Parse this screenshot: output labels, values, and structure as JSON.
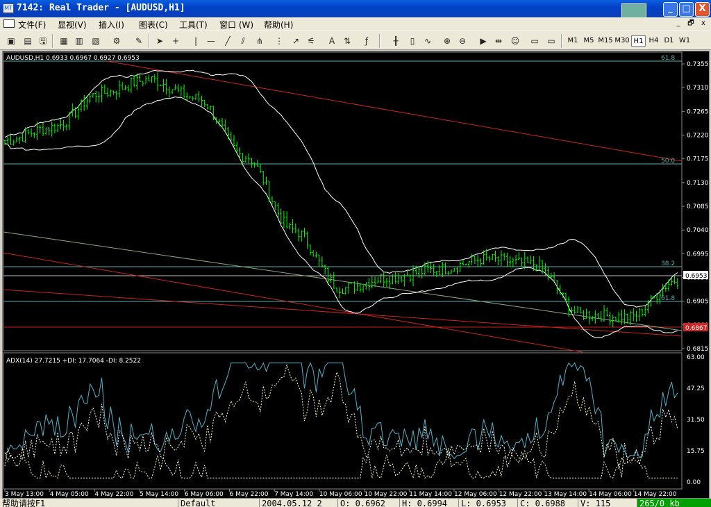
{
  "window": {
    "app_icon": "MT",
    "title": "7142: Real Trader - [AUDUSD,H1]",
    "controls": {
      "minimize": "_",
      "maximize": "□",
      "close": "X"
    }
  },
  "menu": {
    "items": [
      "文件(F)",
      "显视(V)",
      "插入(I)",
      "图表(C)",
      "工具(T)",
      "窗口 (W)",
      "帮助(H)"
    ],
    "mdi": [
      "_",
      "🗗",
      "x"
    ]
  },
  "toolbar": {
    "timeframes": [
      "M1",
      "M5",
      "M15",
      "M30",
      "H1",
      "H4",
      "D1",
      "W1"
    ],
    "active_timeframe": "H1",
    "icons": [
      "new-chart",
      "open",
      "save",
      "print",
      "print-preview",
      "properties",
      "cursor",
      "crosshair",
      "vertical-line",
      "horizontal-line",
      "trendline",
      "channel",
      "pitchfork",
      "gann-fan",
      "text",
      "arrows",
      "fibonacci",
      "bar-chart",
      "candle-chart",
      "line-chart",
      "zoom-in",
      "zoom-out",
      "auto-scroll",
      "chart-shift",
      "expert"
    ]
  },
  "chart": {
    "symbol_header": "AUDUSD,H1  0.6933 0.6967 0.6927 0.6953",
    "indicator_header": "ADX(14) 27.7215 +DI: 17.7064  -DI: 8.2522",
    "price_ticks": [
      "0.7355",
      "0.7310",
      "0.7265",
      "0.7220",
      "0.7175",
      "0.7130",
      "0.7085",
      "0.7040",
      "0.6995",
      "0.6950",
      "0.6905",
      "0.6860",
      "0.6815"
    ],
    "current_price": "0.6953",
    "red_level_label": "0.6867",
    "fib_labels": [
      "61.8",
      "50.0",
      "38.2",
      "61.8"
    ],
    "adx_ticks": [
      "63.00",
      "47.25",
      "31.50",
      "15.75",
      "0.00"
    ],
    "time_labels": [
      "3 May 13:00",
      "4 May 05:00",
      "4 May 22:00",
      "5 May 14:00",
      "6 May 06:00",
      "6 May 22:00",
      "7 May 14:00",
      "10 May 06:00",
      "10 May 22:00",
      "11 May 14:00",
      "12 May 06:00",
      "12 May 22:00",
      "13 May 14:00",
      "14 May 06:00",
      "14 May 22:00"
    ],
    "colors": {
      "bars": "#00ff00",
      "bands": "#ffffff",
      "fib": "#4fb3b3",
      "trend": "#cc2222",
      "adx": "#4fb3c8",
      "di": "#ffffff"
    }
  },
  "chart_data": {
    "type": "line",
    "title": "AUDUSD,H1",
    "x": [
      "3 May 13:00",
      "4 May 05:00",
      "4 May 22:00",
      "5 May 14:00",
      "6 May 06:00",
      "6 May 22:00",
      "7 May 14:00",
      "10 May 06:00",
      "10 May 22:00",
      "11 May 14:00",
      "12 May 06:00",
      "12 May 22:00",
      "13 May 14:00",
      "14 May 06:00",
      "14 May 22:00"
    ],
    "series": [
      {
        "values": [
          0.721,
          0.7235,
          0.73,
          0.7325,
          0.729,
          0.718,
          0.704,
          0.693,
          0.695,
          0.6965,
          0.6985,
          0.6975,
          0.688,
          0.6875,
          0.6945
        ]
      }
    ],
    "ylim": [
      0.6815,
      0.7355
    ]
  },
  "status": {
    "help": "帮助请按F1",
    "profile": "Default",
    "datetime": "2004.05.12 2",
    "open": "O: 0.6962",
    "high": "H: 0.6994",
    "low": "L: 0.6953",
    "close": "C: 0.6988",
    "volume": "V: 115",
    "traffic": "265/0 kb"
  }
}
